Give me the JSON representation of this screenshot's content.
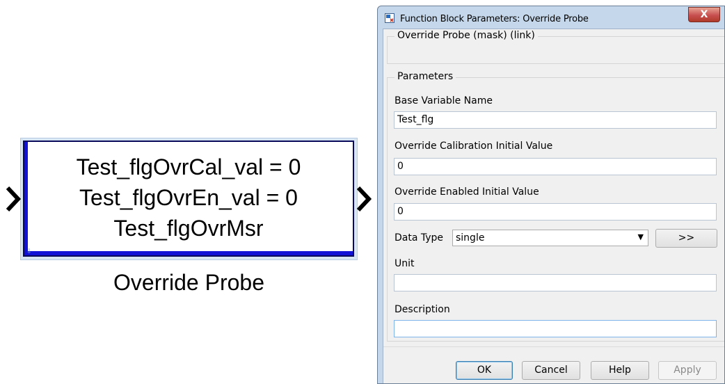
{
  "block": {
    "lines": [
      "Test_flgOvrCal_val = 0",
      "Test_flgOvrEn_val = 0",
      "Test_flgOvrMsr"
    ],
    "name": "Override Probe"
  },
  "dialog": {
    "title": "Function Block Parameters: Override Probe",
    "close_glyph": "X",
    "mask_header": "Override Probe (mask) (link)",
    "parameters_legend": "Parameters",
    "base_variable_name": {
      "label": "Base Variable Name",
      "value": "Test_flg"
    },
    "override_cal_initial": {
      "label": "Override Calibration Initial Value",
      "value": "0"
    },
    "override_enabled_initial": {
      "label": "Override Enabled Initial Value",
      "value": "0"
    },
    "data_type": {
      "label": "Data Type",
      "value": "single",
      "assistant_label": ">>"
    },
    "unit": {
      "label": "Unit",
      "value": ""
    },
    "description": {
      "label": "Description",
      "value": ""
    },
    "buttons": {
      "ok": "OK",
      "cancel": "Cancel",
      "help": "Help",
      "apply": "Apply"
    }
  },
  "icons": {
    "app": "simulink-block-icon",
    "close": "close-icon",
    "dropdown": "chevron-down-icon",
    "input_port": "input-port-chevron-icon",
    "output_port": "output-port-chevron-icon"
  },
  "colors": {
    "block_accent": "#1212d6",
    "dialog_frame": "#c5d7ea",
    "close_button": "#c75050"
  }
}
